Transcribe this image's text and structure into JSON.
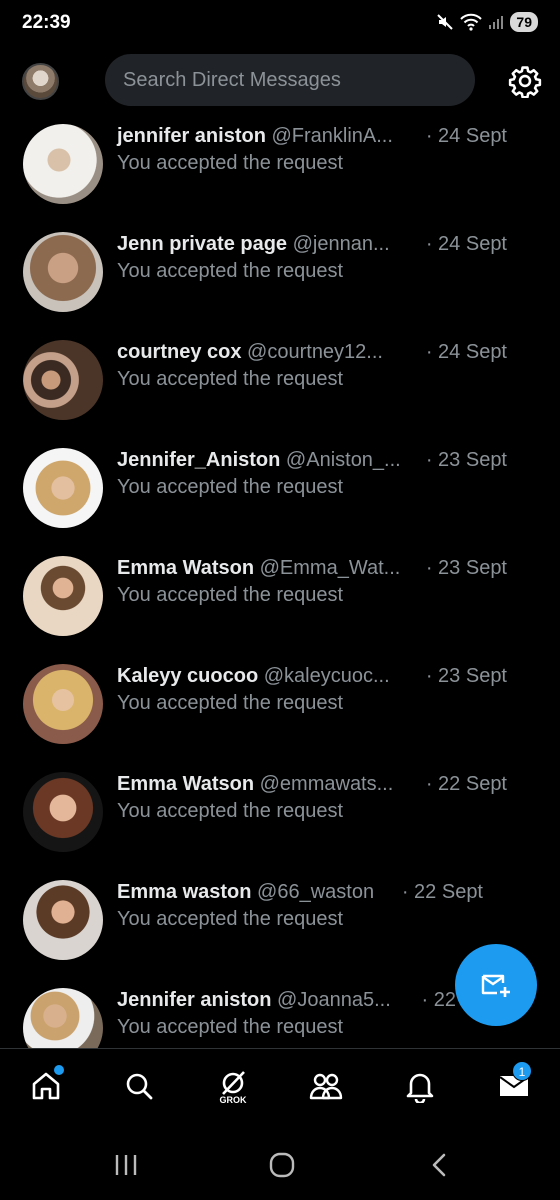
{
  "status": {
    "time": "22:39",
    "battery": "79"
  },
  "header": {
    "search_placeholder": "Search Direct Messages"
  },
  "conversations": [
    {
      "name": "jennifer aniston",
      "handle": "@FranklinA...",
      "date": "24 Sept",
      "preview": "You accepted the request"
    },
    {
      "name": "Jenn private page",
      "handle": "@jennan...",
      "date": "24 Sept",
      "preview": "You accepted the request"
    },
    {
      "name": "courtney cox",
      "handle": "@courtney12...",
      "date": "24 Sept",
      "preview": "You accepted the request"
    },
    {
      "name": "Jennifer_Aniston",
      "handle": "@Aniston_...",
      "date": "23 Sept",
      "preview": "You accepted the request"
    },
    {
      "name": "Emma Watson",
      "handle": "@Emma_Wat...",
      "date": "23 Sept",
      "preview": "You accepted the request"
    },
    {
      "name": "Kaleyy cuocoo",
      "handle": "@kaleycuoc...",
      "date": "23 Sept",
      "preview": "You accepted the request"
    },
    {
      "name": "Emma Watson",
      "handle": "@emmawats...",
      "date": "22 Sept",
      "preview": "You accepted the request"
    },
    {
      "name": "Emma waston",
      "handle": "@66_waston",
      "date": "22 Sept",
      "preview": "You accepted the request"
    },
    {
      "name": "Jennifer aniston",
      "handle": "@Joanna5...",
      "date": "22",
      "preview": "You accepted the request"
    }
  ],
  "nav": {
    "grok_label": "GROK",
    "messages_badge": "1"
  },
  "colors": {
    "accent": "#1d9bf0",
    "background": "#000000",
    "muted_text": "#8b9298"
  },
  "icons": [
    "mute-icon",
    "wifi-icon",
    "signal-icon",
    "settings-gear-icon",
    "new-message-icon",
    "home-icon",
    "search-icon",
    "grok-icon",
    "communities-icon",
    "notifications-bell-icon",
    "messages-envelope-icon",
    "recents-icon",
    "home-button-icon",
    "back-icon"
  ]
}
